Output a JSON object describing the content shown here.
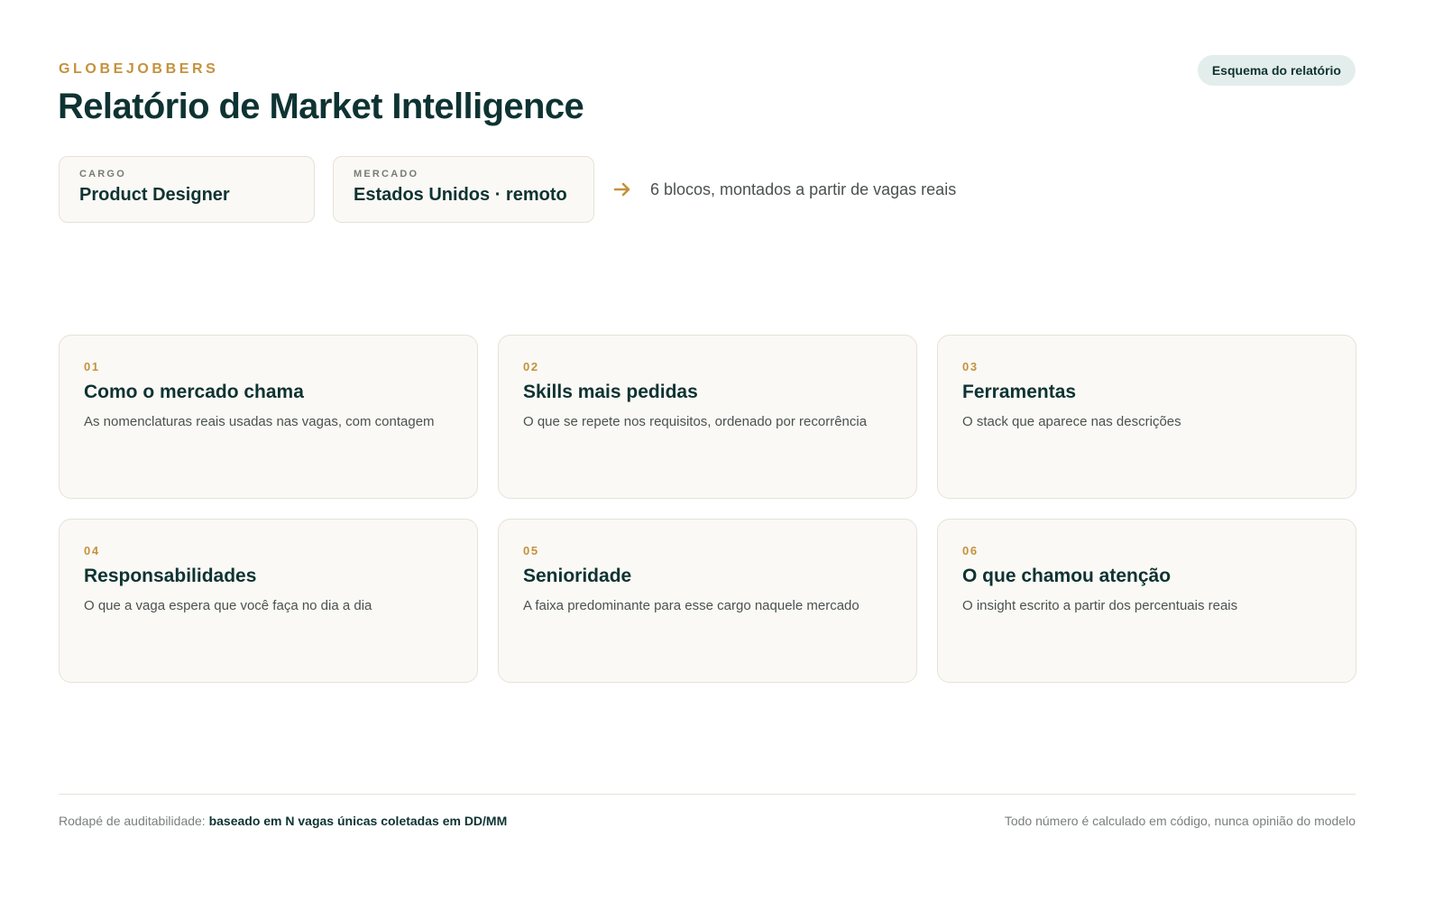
{
  "header": {
    "brand": "GLOBEJOBBERS",
    "title": "Relatório de Market Intelligence",
    "badge": "Esquema do relatório"
  },
  "params": {
    "cargo": {
      "label": "CARGO",
      "value": "Product Designer"
    },
    "mercado": {
      "label": "MERCADO",
      "value": "Estados Unidos · remoto"
    },
    "summary": "6 blocos, montados a partir de vagas reais",
    "arrow_icon": "arrow-right-icon"
  },
  "blocks": [
    {
      "number": "01",
      "title": "Como o mercado chama",
      "description": "As nomenclaturas reais usadas nas vagas, com contagem"
    },
    {
      "number": "02",
      "title": "Skills mais pedidas",
      "description": "O que se repete nos requisitos, ordenado por recorrência"
    },
    {
      "number": "03",
      "title": "Ferramentas",
      "description": "O stack que aparece nas descrições"
    },
    {
      "number": "04",
      "title": "Responsabilidades",
      "description": "O que a vaga espera que você faça no dia a dia"
    },
    {
      "number": "05",
      "title": "Senioridade",
      "description": "A faixa predominante para esse cargo naquele mercado"
    },
    {
      "number": "06",
      "title": "O que chamou atenção",
      "description": "O insight escrito a partir dos percentuais reais"
    }
  ],
  "footer": {
    "audit_label": "Rodapé de auditabilidade: ",
    "audit_value": "baseado em N vagas únicas coletadas em DD/MM",
    "note": "Todo número é calculado em código, nunca opinião do modelo"
  },
  "colors": {
    "accent": "#c4923d",
    "primary": "#0e3332",
    "card_bg": "#faf9f5",
    "border": "#e6e2d8",
    "badge_bg": "#e3eeec"
  }
}
